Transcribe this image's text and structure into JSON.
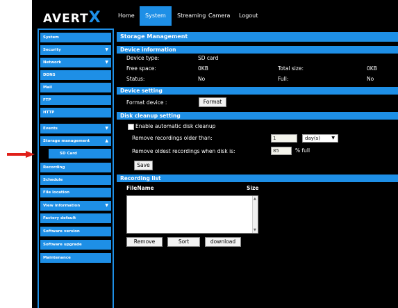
{
  "brand": {
    "logo_text": "AVERT",
    "logo_mark": "X"
  },
  "topnav": {
    "items": [
      "Home",
      "System",
      "Streaming",
      "Camera",
      "Logout"
    ],
    "active": "System"
  },
  "sidebar": {
    "items": [
      {
        "label": "System",
        "arrow": ""
      },
      {
        "label": "Security",
        "arrow": "▼"
      },
      {
        "label": "Network",
        "arrow": "▼"
      },
      {
        "label": "DDNS",
        "arrow": ""
      },
      {
        "label": "Mail",
        "arrow": ""
      },
      {
        "label": "FTP",
        "arrow": ""
      },
      {
        "label": "HTTP",
        "arrow": ""
      },
      {
        "label": "Events",
        "arrow": "▼"
      },
      {
        "label": "Storage management",
        "arrow": "▲"
      },
      {
        "label": "SD Card",
        "arrow": ""
      },
      {
        "label": "Recording",
        "arrow": ""
      },
      {
        "label": "Schedule",
        "arrow": ""
      },
      {
        "label": "File location",
        "arrow": ""
      },
      {
        "label": "View information",
        "arrow": "▼"
      },
      {
        "label": "Factory default",
        "arrow": ""
      },
      {
        "label": "Software version",
        "arrow": ""
      },
      {
        "label": "Software upgrade",
        "arrow": ""
      },
      {
        "label": "Maintenance",
        "arrow": ""
      }
    ]
  },
  "main": {
    "title": "Storage Management",
    "device_info": {
      "header": "Device information",
      "device_type_label": "Device type:",
      "device_type_value": "SD card",
      "free_space_label": "Free space:",
      "free_space_value": "0KB",
      "total_size_label": "Total size:",
      "total_size_value": "0KB",
      "status_label": "Status:",
      "status_value": "No",
      "full_label": "Full:",
      "full_value": "No"
    },
    "device_setting": {
      "header": "Device setting",
      "format_label": "Format device :",
      "format_button": "Format"
    },
    "cleanup": {
      "header": "Disk cleanup setting",
      "enable_label": "Enable automatic disk cleanup",
      "older_label": "Remove recordings older than:",
      "older_value": "1",
      "older_unit": "day(s)",
      "oldest_label": "Remove oldest recordings when disk is:",
      "oldest_value": "85",
      "oldest_unit": "% full",
      "save_button": "Save"
    },
    "recording_list": {
      "header": "Recording list",
      "col_filename": "FileName",
      "col_size": "Size",
      "remove_button": "Remove",
      "sort_button": "Sort",
      "download_button": "download"
    }
  },
  "colors": {
    "accent": "#1e8fe6",
    "background": "#000000",
    "annotation_arrow": "#e0201a"
  }
}
